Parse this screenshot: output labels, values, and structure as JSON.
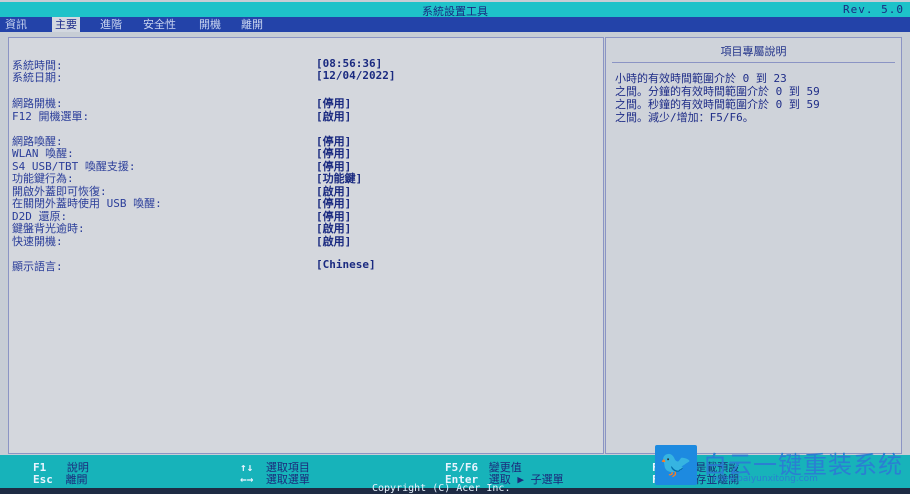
{
  "titlebar": {
    "title": "系統設置工具",
    "rev": "Rev. 5.0"
  },
  "menu": {
    "tabs": [
      {
        "label": "資訊"
      },
      {
        "label": "主要"
      },
      {
        "label": "進階"
      },
      {
        "label": "安全性"
      },
      {
        "label": "開機"
      },
      {
        "label": "離開"
      }
    ]
  },
  "settings": [
    {
      "label": "系統時間:",
      "value": "[08:56:36]"
    },
    {
      "label": "系統日期:",
      "value": "[12/04/2022]"
    },
    {
      "label": "網路開機:",
      "value": "[停用]"
    },
    {
      "label": "F12 開機選單:",
      "value": "[啟用]"
    },
    {
      "label": "網路喚醒:",
      "value": "[停用]"
    },
    {
      "label": "WLAN 喚醒:",
      "value": "[停用]"
    },
    {
      "label": "S4 USB/TBT 喚醒支援:",
      "value": "[停用]"
    },
    {
      "label": "功能鍵行為:",
      "value": "[功能鍵]"
    },
    {
      "label": "開啟外蓋即可恢復:",
      "value": "[啟用]"
    },
    {
      "label": "在關閉外蓋時使用 USB 喚醒:",
      "value": "[停用]"
    },
    {
      "label": "D2D 還原:",
      "value": "[停用]"
    },
    {
      "label": "鍵盤背光逾時:",
      "value": "[啟用]"
    },
    {
      "label": "快速開機:",
      "value": "[啟用]"
    },
    {
      "label": "顯示語言:",
      "value": "[Chinese]"
    }
  ],
  "help": {
    "title": "項目專屬說明",
    "lines": [
      "小時的有效時間範圍介於 0 到 23",
      "之間。分鐘的有效時間範圍介於 0 到 59",
      "之間。秒鐘的有效時間範圍介於 0 到 59",
      "之間。減少/增加：F5/F6。"
    ]
  },
  "footer": {
    "keys": [
      {
        "key": "F1",
        "desc": "說明"
      },
      {
        "key": "Esc",
        "desc": "離開"
      },
      {
        "key": "↑↓",
        "desc": "選取項目"
      },
      {
        "key": "←→",
        "desc": "選取選單"
      },
      {
        "key": "F5/F6",
        "desc": "變更值"
      },
      {
        "key": "Enter",
        "desc": "選取 ▶ 子選單"
      },
      {
        "key": "F",
        "desc": "是載預設"
      },
      {
        "key": "F",
        "desc": "存並離開"
      }
    ],
    "copyright": "Copyright (C) Acer Inc."
  },
  "watermark": {
    "icon": "twitter-bird-icon",
    "brand": "白云一键重装系统",
    "url": "www.baiyunxitong.com"
  },
  "colors": {
    "title_bar": "#1ec2c9",
    "menu_bar": "#2343a9",
    "panel": "#d4d7dd",
    "text": "#22338a",
    "footer": "#17b3ba"
  }
}
